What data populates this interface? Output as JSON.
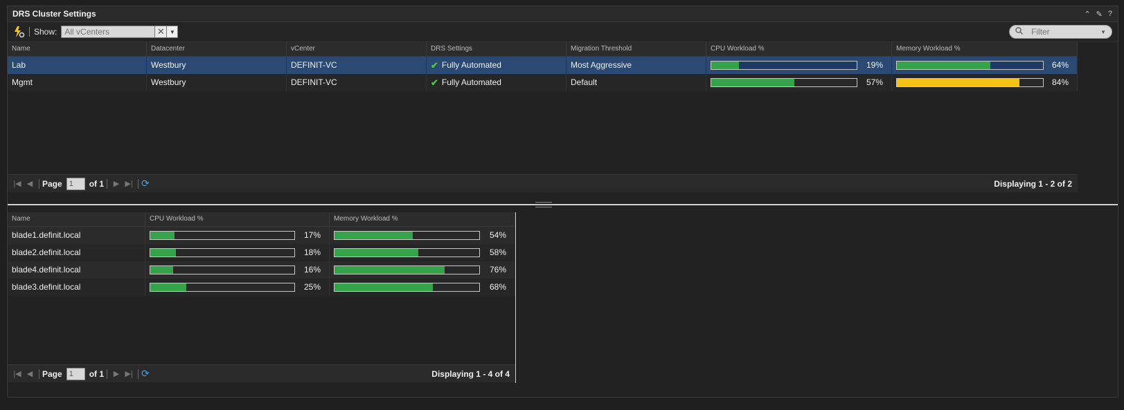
{
  "panel": {
    "title": "DRS Cluster Settings",
    "tools": {
      "collapse": "⌃",
      "edit": "✎",
      "help": "?"
    }
  },
  "toolbar": {
    "show_label": "Show:",
    "vcenter_placeholder": "All vCenters",
    "filter_placeholder": "Filter"
  },
  "clusters": {
    "columns": [
      "Name",
      "Datacenter",
      "vCenter",
      "DRS Settings",
      "Migration Threshold",
      "CPU Workload %",
      "Memory Workload %"
    ],
    "rows": [
      {
        "name": "Lab",
        "datacenter": "Westbury",
        "vcenter": "DEFINIT-VC",
        "drs": "Fully Automated",
        "threshold": "Most Aggressive",
        "cpu": 19,
        "cpu_label": "19%",
        "mem": 64,
        "mem_label": "64%",
        "mem_status": "ok",
        "selected": true
      },
      {
        "name": "Mgmt",
        "datacenter": "Westbury",
        "vcenter": "DEFINIT-VC",
        "drs": "Fully Automated",
        "threshold": "Default",
        "cpu": 57,
        "cpu_label": "57%",
        "mem": 84,
        "mem_label": "84%",
        "mem_status": "warning",
        "selected": false
      }
    ],
    "pager": {
      "page_label": "Page",
      "page_value": "1",
      "of_label": "of 1",
      "display": "Displaying 1 - 2 of 2"
    }
  },
  "hosts": {
    "columns": [
      "Name",
      "CPU Workload %",
      "Memory Workload %"
    ],
    "rows": [
      {
        "name": "blade1.definit.local",
        "cpu": 17,
        "cpu_label": "17%",
        "mem": 54,
        "mem_label": "54%"
      },
      {
        "name": "blade2.definit.local",
        "cpu": 18,
        "cpu_label": "18%",
        "mem": 58,
        "mem_label": "58%"
      },
      {
        "name": "blade4.definit.local",
        "cpu": 16,
        "cpu_label": "16%",
        "mem": 76,
        "mem_label": "76%"
      },
      {
        "name": "blade3.definit.local",
        "cpu": 25,
        "cpu_label": "25%",
        "mem": 68,
        "mem_label": "68%"
      }
    ],
    "pager": {
      "page_label": "Page",
      "page_value": "1",
      "of_label": "of 1",
      "display": "Displaying 1 - 4 of 4"
    }
  },
  "colors": {
    "ok": "#34a34a",
    "warning": "#f6c214",
    "selected": "#2a4a73"
  }
}
